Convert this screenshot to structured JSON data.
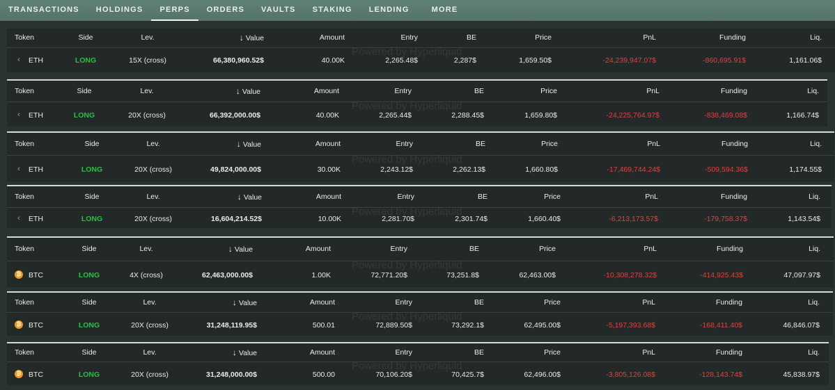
{
  "nav": {
    "tabs": [
      "TRANSACTIONS",
      "HOLDINGS",
      "PERPS",
      "ORDERS",
      "VAULTS",
      "STAKING",
      "LENDING",
      "MORE"
    ],
    "active": "PERPS"
  },
  "watermark": "Powered by Hyperliquid",
  "columns": [
    "Token",
    "Side",
    "Lev.",
    "Value",
    "Amount",
    "Entry",
    "BE",
    "Price",
    "PnL",
    "Funding",
    "Liq."
  ],
  "colors": {
    "long": "#2dbd48",
    "negative": "#e0403f",
    "btc": "#f29a1f",
    "nav": "#5a7a6e",
    "panel": "#232928"
  },
  "positions": [
    {
      "token": "ETH",
      "icon": "eth-icon",
      "side": "LONG",
      "lev": "15X (cross)",
      "value": "66,380,960.52$",
      "amount": "40.00K",
      "entry": "2,265.48$",
      "be": "2,287$",
      "price": "1,659.50$",
      "pnl": "-24,239,947.07$",
      "funding": "-860,695.91$",
      "liq": "1,161.06$"
    },
    {
      "token": "ETH",
      "icon": "eth-icon",
      "side": "LONG",
      "lev": "20X (cross)",
      "value": "66,392,000.00$",
      "amount": "40.00K",
      "entry": "2,265.44$",
      "be": "2,288.45$",
      "price": "1,659.80$",
      "pnl": "-24,225,764.97$",
      "funding": "-838,469.08$",
      "liq": "1,166.74$"
    },
    {
      "token": "ETH",
      "icon": "eth-icon",
      "side": "LONG",
      "lev": "20X (cross)",
      "value": "49,824,000.00$",
      "amount": "30.00K",
      "entry": "2,243.12$",
      "be": "2,262.13$",
      "price": "1,660.80$",
      "pnl": "-17,469,744.24$",
      "funding": "-509,594.36$",
      "liq": "1,174.55$"
    },
    {
      "token": "ETH",
      "icon": "eth-icon",
      "side": "LONG",
      "lev": "20X (cross)",
      "value": "16,604,214.52$",
      "amount": "10.00K",
      "entry": "2,281.70$",
      "be": "2,301.74$",
      "price": "1,660.40$",
      "pnl": "-6,213,173.57$",
      "funding": "-179,758.37$",
      "liq": "1,143.54$"
    },
    {
      "token": "BTC",
      "icon": "btc-icon",
      "side": "LONG",
      "lev": "4X (cross)",
      "value": "62,463,000.00$",
      "amount": "1.00K",
      "entry": "72,771.20$",
      "be": "73,251.8$",
      "price": "62,463.00$",
      "pnl": "-10,308,278.32$",
      "funding": "-414,925.43$",
      "liq": "47,097.97$"
    },
    {
      "token": "BTC",
      "icon": "btc-icon",
      "side": "LONG",
      "lev": "20X (cross)",
      "value": "31,248,119.95$",
      "amount": "500.01",
      "entry": "72,889.50$",
      "be": "73,292.1$",
      "price": "62,495.00$",
      "pnl": "-5,197,393.68$",
      "funding": "-168,411.40$",
      "liq": "46,846.07$"
    },
    {
      "token": "BTC",
      "icon": "btc-icon",
      "side": "LONG",
      "lev": "20X (cross)",
      "value": "31,248,000.00$",
      "amount": "500.00",
      "entry": "70,106.20$",
      "be": "70,425.7$",
      "price": "62,496.00$",
      "pnl": "-3,805,126.08$",
      "funding": "-128,143.74$",
      "liq": "45,838.97$"
    }
  ]
}
